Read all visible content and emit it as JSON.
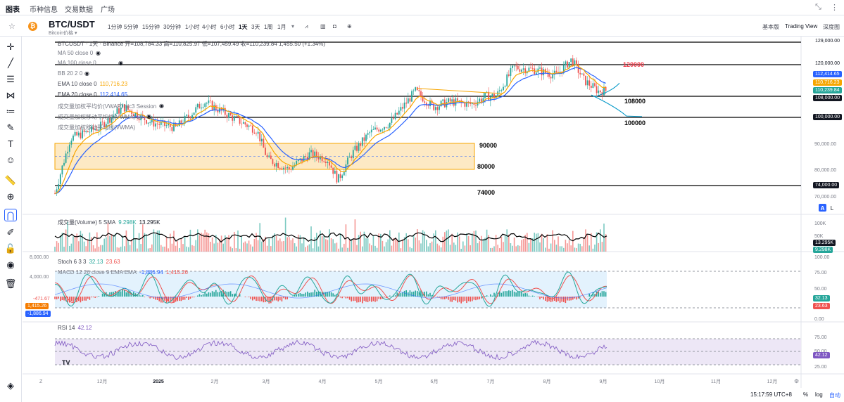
{
  "topnav": {
    "tabs": [
      "图表",
      "币种信息",
      "交易数据",
      "广场"
    ]
  },
  "symbol": {
    "name": "BTC/USDT",
    "sub": "Bitcoin价格 ▾"
  },
  "timeframes": [
    "1分钟",
    "5分钟",
    "15分钟",
    "30分钟",
    "1小时",
    "4小时",
    "6小时",
    "1天",
    "3天",
    "1周",
    "1月"
  ],
  "toolbar_right": [
    "基本版",
    "Trading View",
    "深度图"
  ],
  "legend": {
    "ohlc": "BTCUSDT · 1天 · Binance  开=108,784.33 高=110,825.97 低=107,459.49 收=110,239.84 1,455.50 (+1.34%)",
    "ma50": "MA 50 close 0",
    "ma100": "MA 100 close 0",
    "bb": "BB 20 2 0",
    "ema10": "EMA 10 close 0",
    "ema10_val": "110,716.23",
    "ema20": "EMA 20 close 0",
    "ema20_val": "112,414.65",
    "vwap": "成交量加权平均价(VWAP) hlc3 Session",
    "vol_profile": "成交量加权移动平均线(VWMA) 20",
    "vwma": "成交量加权移动平均线(VWMA)",
    "volume": "成交量(Volume) 5 SMA",
    "volume_v1": "9.298K",
    "volume_v2": "13.295K",
    "stoch": "Stoch 6 3 3",
    "stoch_k": "32.13",
    "stoch_d": "23.63",
    "macd": "MACD 12 26 close 9 EMA EMA",
    "macd_v1": "-471.67",
    "macd_v2": "-1,886.94",
    "macd_v3": "1,415.26",
    "rsi": "RSI 14",
    "rsi_val": "42.12"
  },
  "annotations": {
    "l129": "129000",
    "l120": "120000",
    "l108": "108000",
    "l100": "100000",
    "l90": "90000",
    "l80": "80000",
    "l74": "74000"
  },
  "price_axis": [
    "129,000.00",
    "120,000.00",
    "110,000.00",
    "100,000.00",
    "90,000.00",
    "80,000.00",
    "74,000.00",
    "70,000.00"
  ],
  "price_labels": {
    "p1": "112,414.65",
    "p2": "110,716.23",
    "p3": "110,239.84",
    "p4": "108,000.00",
    "p5": "100,000.00"
  },
  "vol_axis": [
    "100K",
    "50K",
    "13.295K",
    "9.298K"
  ],
  "macd_axis": [
    "8,000.00",
    "4,000.00"
  ],
  "macd_labels": {
    "a": "-471.67",
    "b": "1,415.26",
    "c": "-1,886.94"
  },
  "stoch_axis": [
    "100.00",
    "75.00",
    "50.00",
    "32.13",
    "23.63",
    "0.00"
  ],
  "rsi_axis": [
    "75.00",
    "50.00",
    "42.12",
    "25.00"
  ],
  "time_axis": [
    "12月",
    "2025",
    "2月",
    "3月",
    "4月",
    "5月",
    "6月",
    "7月",
    "8月",
    "9月",
    "10月",
    "11月",
    "12月"
  ],
  "bottom": {
    "time": "15:17:59 UTC+8",
    "pct": "%",
    "log": "log",
    "auto": "自动"
  },
  "colors": {
    "up": "#26a69a",
    "down": "#ef5350",
    "ema10": "#f7a600",
    "ema20": "#2962ff",
    "black": "#000000",
    "red_ann": "#f23645",
    "zone": "#fde9c4"
  }
}
